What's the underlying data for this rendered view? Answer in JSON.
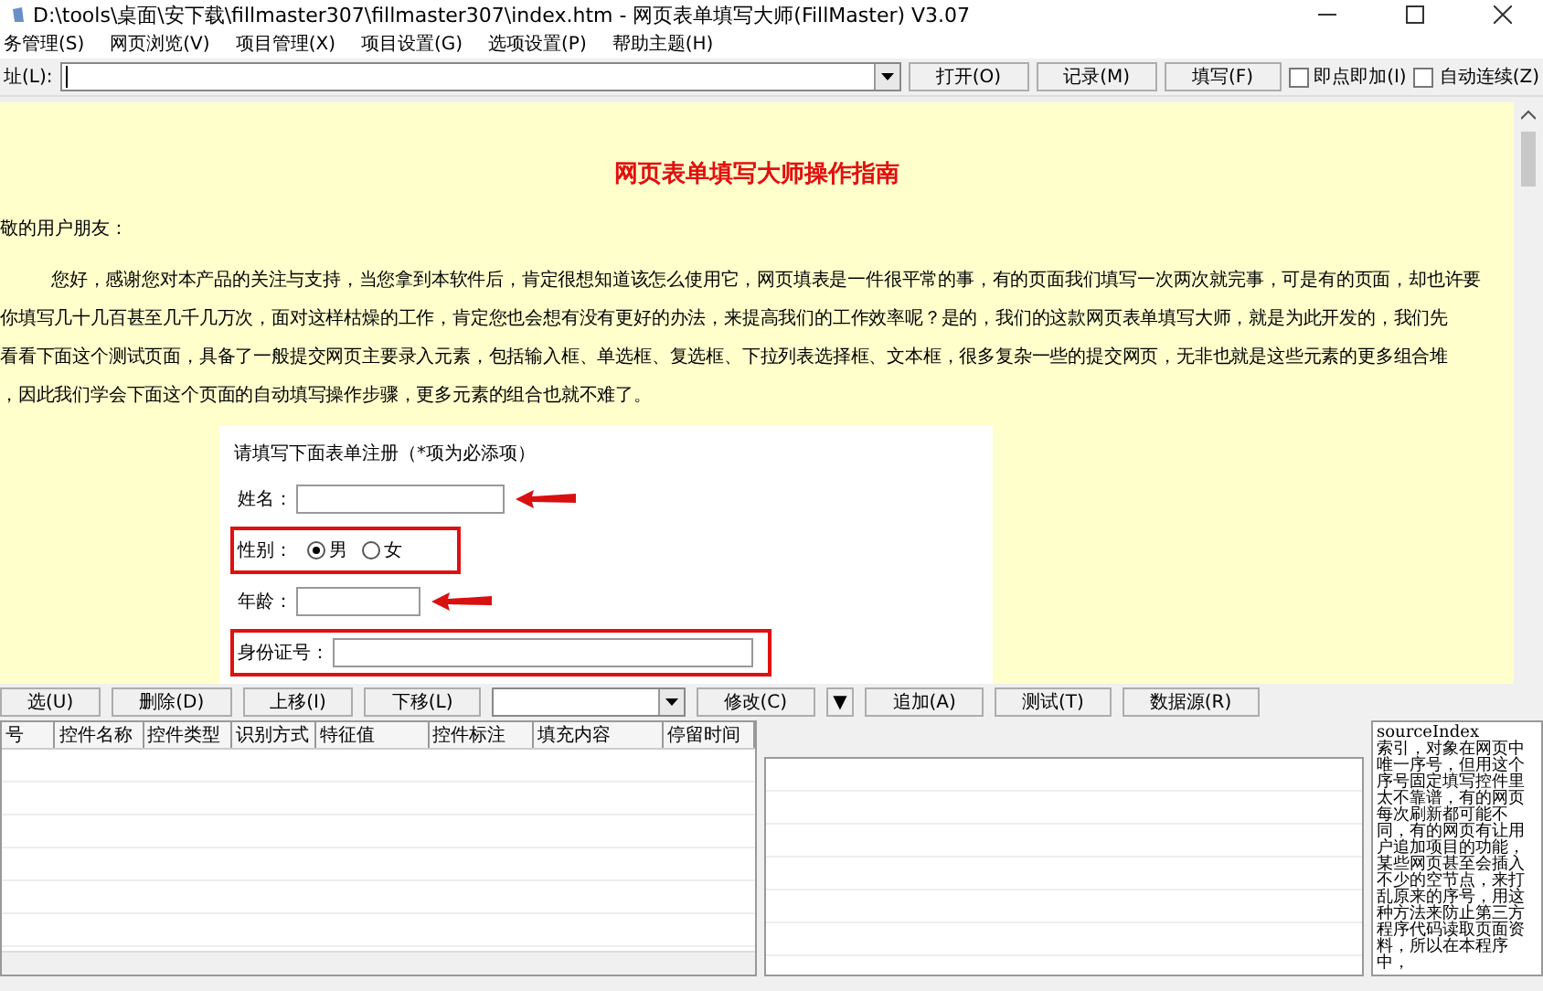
{
  "window": {
    "title": "D:\\tools\\桌面\\安下载\\fillmaster307\\fillmaster307\\index.htm - 网页表单填写大师(FillMaster) V3.07"
  },
  "menu": [
    "务管理(S)",
    "网页浏览(V)",
    "项目管理(X)",
    "项目设置(G)",
    "选项设置(P)",
    "帮助主题(H)"
  ],
  "address_bar": {
    "label": "址(L):",
    "buttons": [
      "打开(O)",
      "记录(M)",
      "填写(F)"
    ],
    "checkboxes": [
      {
        "label": "即点即加(I)",
        "checked": false
      },
      {
        "label": "自动连续(Z)",
        "checked": false
      }
    ]
  },
  "page": {
    "heading": "网页表单填写大师操作指南",
    "greeting": "敬的用户朋友：",
    "paragraph_lines": [
      "您好，感谢您对本产品的关注与支持，当您拿到本软件后，肯定很想知道该怎么使用它，网页填表是一件很平常的事，有的页面我们填写一次两次就完事，可是有的页面，却也许要",
      "你填写几十几百甚至几千几万次，面对这样枯燥的工作，肯定您也会想有没有更好的办法，来提高我们的工作效率呢？是的，我们的这款网页表单填写大师，就是为此开发的，我们先",
      "看看下面这个测试页面，具备了一般提交网页主要录入元素，包括输入框、单选框、复选框、下拉列表选择框、文本框，很多复杂一些的提交网页，无非也就是这些元素的更多组合堆",
      "，因此我们学会下面这个页面的自动填写操作步骤，更多元素的组合也就不难了。"
    ],
    "form": {
      "intro": "请填写下面表单注册（*项为必添项）",
      "fields": [
        {
          "kind": "text",
          "label": "姓名：",
          "arrow": true,
          "boxed": false
        },
        {
          "kind": "radio",
          "label": "性别：",
          "boxed": true,
          "options": [
            {
              "label": "男",
              "selected": true
            },
            {
              "label": "女",
              "selected": false
            }
          ]
        },
        {
          "kind": "short",
          "label": "年龄：",
          "arrow": true,
          "boxed": false
        },
        {
          "kind": "wide",
          "label": "身份证号：",
          "arrow": false,
          "boxed": true
        }
      ]
    }
  },
  "toolbar": {
    "buttons_left": [
      "选(U)",
      "删除(D)",
      "上移(I)",
      "下移(L)"
    ],
    "buttons_right": [
      "修改(C)",
      "▼",
      "追加(A)",
      "测试(T)",
      "数据源(R)"
    ]
  },
  "table": {
    "columns": [
      "号",
      "控件名称",
      "控件类型",
      "识别方式",
      "特征值",
      "控件标注",
      "填充内容",
      "停留时间"
    ]
  },
  "help": {
    "title": "sourceIndex",
    "text": "索引，对象在网页中唯一序号，但用这个序号固定填写控件里太不靠谱，有的网页每次刷新都可能不同，有的网页有让用户追加项目的功能，某些网页甚至会插入不少的空节点，来打乱原来的序号，用这种方法来防止第三方程序代码读取页面资料，所以在本程序中，"
  }
}
